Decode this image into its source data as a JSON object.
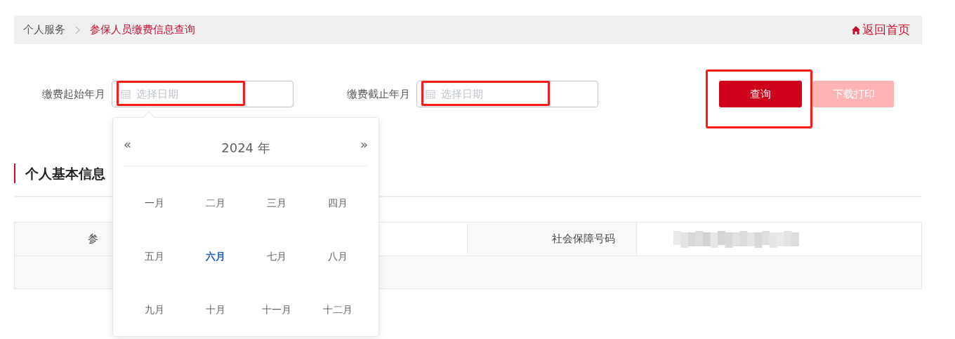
{
  "breadcrumb": {
    "items": [
      {
        "label": "个人服务",
        "selected": false
      },
      {
        "label": "参保人员缴费信息查询",
        "selected": true
      }
    ],
    "home_link": "返回首页"
  },
  "form": {
    "fields": [
      {
        "label": "缴费起始年月",
        "placeholder": "选择日期"
      },
      {
        "label": "缴费截止年月",
        "placeholder": "选择日期"
      }
    ],
    "buttons": [
      {
        "label": "查询",
        "disabled": false
      },
      {
        "label": "下载打印",
        "disabled": true
      }
    ]
  },
  "section": {
    "title": "个人基本信息"
  },
  "table": {
    "rows": [
      [
        {
          "text": "参",
          "kind": "label"
        },
        {
          "kind": "value"
        },
        {
          "text": "社会保障号码",
          "kind": "label"
        },
        {
          "kind": "redacted"
        }
      ],
      []
    ]
  },
  "date_picker": {
    "prev": "«",
    "year": "2024 年",
    "next": "»",
    "months": [
      {
        "label": "一月",
        "selected": false
      },
      {
        "label": "二月",
        "selected": false
      },
      {
        "label": "三月",
        "selected": false
      },
      {
        "label": "四月",
        "selected": false
      },
      {
        "label": "五月",
        "selected": false
      },
      {
        "label": "六月",
        "selected": true
      },
      {
        "label": "七月",
        "selected": false
      },
      {
        "label": "八月",
        "selected": false
      },
      {
        "label": "九月",
        "selected": false
      },
      {
        "label": "十月",
        "selected": false
      },
      {
        "label": "十一月",
        "selected": false
      },
      {
        "label": "十二月",
        "selected": false
      }
    ]
  }
}
